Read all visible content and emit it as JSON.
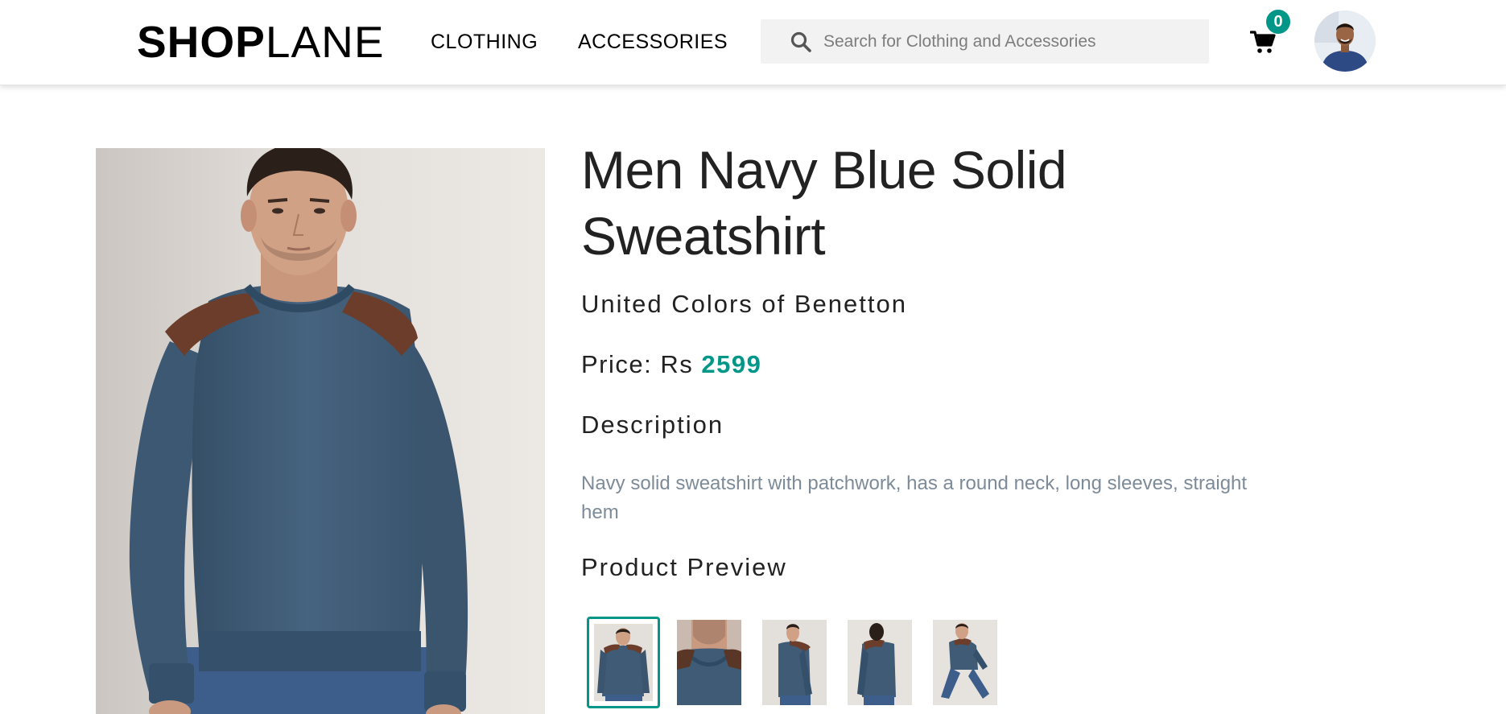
{
  "header": {
    "logo_bold": "SHOP",
    "logo_light": "LANE",
    "nav": [
      {
        "label": "CLOTHING"
      },
      {
        "label": "ACCESSORIES"
      }
    ],
    "search": {
      "placeholder": "Search for Clothing and Accessories",
      "value": ""
    },
    "cart": {
      "count": "0",
      "icon": "cart-icon"
    },
    "avatar_icon": "user-avatar"
  },
  "product": {
    "title": "Men Navy Blue Solid Sweatshirt",
    "brand": "United Colors of Benetton",
    "price_label": "Price: Rs",
    "price_value": "2599",
    "description_heading": "Description",
    "description": "Navy solid sweatshirt with patchwork, has a round neck, long sleeves, straight hem",
    "preview_heading": "Product Preview",
    "thumbnails": [
      {
        "name": "front view",
        "active": true
      },
      {
        "name": "neck detail",
        "active": false
      },
      {
        "name": "side view",
        "active": false
      },
      {
        "name": "back side view",
        "active": false
      },
      {
        "name": "seated view",
        "active": false
      }
    ]
  },
  "colors": {
    "accent": "#009688",
    "sweatshirt": "#3f5b75",
    "patch": "#6b3d2a",
    "description_text": "#7d8b99",
    "search_bg": "#f2f2f2"
  }
}
